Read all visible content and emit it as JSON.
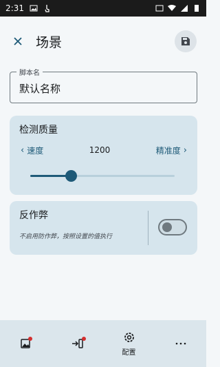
{
  "status_bar": {
    "time": "2:31"
  },
  "app_bar": {
    "close_icon": "close-icon",
    "title": "场景",
    "save_icon": "save-icon"
  },
  "script_name": {
    "label": "脚本名",
    "value": "默认名称"
  },
  "quality": {
    "title": "检测质量",
    "left_label": "速度",
    "value": "1200",
    "right_label": "精准度",
    "slider_fraction": 0.28
  },
  "anti_cheat": {
    "title": "反作弊",
    "description": "不启用防作弊，按照设置的值执行",
    "enabled": false
  },
  "bottom_nav": {
    "items": [
      {
        "icon": "image-edit-icon",
        "label": ""
      },
      {
        "icon": "login-icon",
        "label": ""
      },
      {
        "icon": "gear-icon",
        "label": "配置"
      },
      {
        "icon": "more-horizontal-icon",
        "label": ""
      }
    ]
  },
  "colors": {
    "accent": "#1e5a78",
    "card": "#d6e5ed",
    "badge": "#d32f2f"
  }
}
